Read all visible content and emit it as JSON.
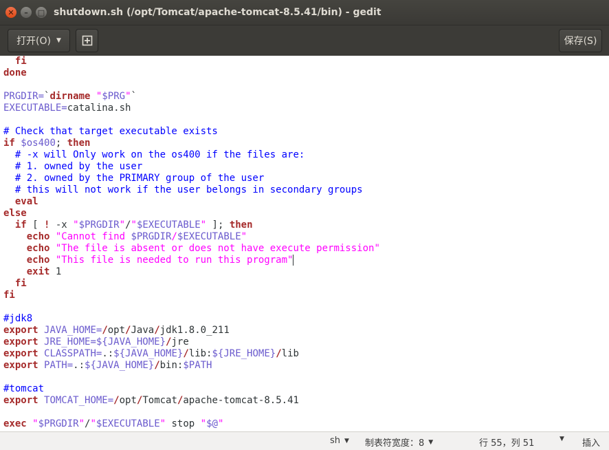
{
  "window": {
    "title": "shutdown.sh (/opt/Tomcat/apache-tomcat-8.5.41/bin) - gedit",
    "close_glyph": "✕",
    "min_glyph": "–",
    "max_glyph": "□"
  },
  "header": {
    "open_label": "打开(O)",
    "open_arrow": "▼",
    "new_tab_glyph": "⊞",
    "save_label": "保存(S)"
  },
  "editor": {
    "lines": [
      [
        {
          "t": "  "
        },
        {
          "t": "fi",
          "c": "kw"
        }
      ],
      [
        {
          "t": "done",
          "c": "kw"
        }
      ],
      [],
      [
        {
          "t": "PRGDIR=",
          "c": "var"
        },
        {
          "t": "`"
        },
        {
          "t": "dirname",
          "c": "kw"
        },
        {
          "t": " "
        },
        {
          "t": "\"",
          "c": "str"
        },
        {
          "t": "$PRG",
          "c": "var"
        },
        {
          "t": "\"",
          "c": "str"
        },
        {
          "t": "`"
        }
      ],
      [
        {
          "t": "EXECUTABLE=",
          "c": "var"
        },
        {
          "t": "catalina.sh"
        }
      ],
      [],
      [
        {
          "t": "# Check that target executable exists",
          "c": "cmt"
        }
      ],
      [
        {
          "t": "if",
          "c": "kw"
        },
        {
          "t": " "
        },
        {
          "t": "$os400",
          "c": "var"
        },
        {
          "t": "; "
        },
        {
          "t": "then",
          "c": "kw"
        }
      ],
      [
        {
          "t": "  "
        },
        {
          "t": "# -x will Only work on the os400 if the files are:",
          "c": "cmt"
        }
      ],
      [
        {
          "t": "  "
        },
        {
          "t": "# 1. owned by the user",
          "c": "cmt"
        }
      ],
      [
        {
          "t": "  "
        },
        {
          "t": "# 2. owned by the PRIMARY group of the user",
          "c": "cmt"
        }
      ],
      [
        {
          "t": "  "
        },
        {
          "t": "# this will not work if the user belongs in secondary groups",
          "c": "cmt"
        }
      ],
      [
        {
          "t": "  "
        },
        {
          "t": "eval",
          "c": "kw"
        }
      ],
      [
        {
          "t": "else",
          "c": "kw"
        }
      ],
      [
        {
          "t": "  "
        },
        {
          "t": "if",
          "c": "kw"
        },
        {
          "t": " [ "
        },
        {
          "t": "!",
          "c": "kw"
        },
        {
          "t": " -x "
        },
        {
          "t": "\"",
          "c": "str"
        },
        {
          "t": "$PRGDIR",
          "c": "var"
        },
        {
          "t": "\"",
          "c": "str"
        },
        {
          "t": "/"
        },
        {
          "t": "\"",
          "c": "str"
        },
        {
          "t": "$EXECUTABLE",
          "c": "var"
        },
        {
          "t": "\"",
          "c": "str"
        },
        {
          "t": " ]; "
        },
        {
          "t": "then",
          "c": "kw"
        }
      ],
      [
        {
          "t": "    "
        },
        {
          "t": "echo",
          "c": "kw"
        },
        {
          "t": " "
        },
        {
          "t": "\"Cannot find ",
          "c": "str"
        },
        {
          "t": "$PRGDIR",
          "c": "var"
        },
        {
          "t": "/",
          "c": "str"
        },
        {
          "t": "$EXECUTABLE",
          "c": "var"
        },
        {
          "t": "\"",
          "c": "str"
        }
      ],
      [
        {
          "t": "    "
        },
        {
          "t": "echo",
          "c": "kw"
        },
        {
          "t": " "
        },
        {
          "t": "\"The file is absent or does not have execute permission\"",
          "c": "str"
        }
      ],
      [
        {
          "t": "    "
        },
        {
          "t": "echo",
          "c": "kw"
        },
        {
          "t": " "
        },
        {
          "t": "\"This file is needed to run this program\"",
          "c": "str"
        },
        {
          "cursor": true
        }
      ],
      [
        {
          "t": "    "
        },
        {
          "t": "exit",
          "c": "kw"
        },
        {
          "t": " 1"
        }
      ],
      [
        {
          "t": "  "
        },
        {
          "t": "fi",
          "c": "kw"
        }
      ],
      [
        {
          "t": "fi",
          "c": "kw"
        }
      ],
      [],
      [
        {
          "t": "#jdk8",
          "c": "cmt"
        }
      ],
      [
        {
          "t": "export",
          "c": "kw"
        },
        {
          "t": " "
        },
        {
          "t": "JAVA_HOME=",
          "c": "var"
        },
        {
          "t": "/",
          "c": "kw"
        },
        {
          "t": "opt"
        },
        {
          "t": "/",
          "c": "kw"
        },
        {
          "t": "Java"
        },
        {
          "t": "/",
          "c": "kw"
        },
        {
          "t": "jdk1.8.0_211"
        }
      ],
      [
        {
          "t": "export",
          "c": "kw"
        },
        {
          "t": " "
        },
        {
          "t": "JRE_HOME=",
          "c": "var"
        },
        {
          "t": "${JAVA_HOME}",
          "c": "var"
        },
        {
          "t": "/",
          "c": "kw"
        },
        {
          "t": "jre"
        }
      ],
      [
        {
          "t": "export",
          "c": "kw"
        },
        {
          "t": " "
        },
        {
          "t": "CLASSPATH=",
          "c": "var"
        },
        {
          "t": ".:"
        },
        {
          "t": "${JAVA_HOME}",
          "c": "var"
        },
        {
          "t": "/",
          "c": "kw"
        },
        {
          "t": "lib:"
        },
        {
          "t": "${JRE_HOME}",
          "c": "var"
        },
        {
          "t": "/",
          "c": "kw"
        },
        {
          "t": "lib"
        }
      ],
      [
        {
          "t": "export",
          "c": "kw"
        },
        {
          "t": " "
        },
        {
          "t": "PATH=",
          "c": "var"
        },
        {
          "t": ".:"
        },
        {
          "t": "${JAVA_HOME}",
          "c": "var"
        },
        {
          "t": "/",
          "c": "kw"
        },
        {
          "t": "bin:"
        },
        {
          "t": "$PATH",
          "c": "var"
        }
      ],
      [],
      [
        {
          "t": "#tomcat",
          "c": "cmt"
        }
      ],
      [
        {
          "t": "export",
          "c": "kw"
        },
        {
          "t": " "
        },
        {
          "t": "TOMCAT_HOME=",
          "c": "var"
        },
        {
          "t": "/",
          "c": "kw"
        },
        {
          "t": "opt"
        },
        {
          "t": "/",
          "c": "kw"
        },
        {
          "t": "Tomcat"
        },
        {
          "t": "/",
          "c": "kw"
        },
        {
          "t": "apache-tomcat-8.5.41"
        }
      ],
      [],
      [
        {
          "t": "exec",
          "c": "kw"
        },
        {
          "t": " "
        },
        {
          "t": "\"",
          "c": "str"
        },
        {
          "t": "$PRGDIR",
          "c": "var"
        },
        {
          "t": "\"",
          "c": "str"
        },
        {
          "t": "/"
        },
        {
          "t": "\"",
          "c": "str"
        },
        {
          "t": "$EXECUTABLE",
          "c": "var"
        },
        {
          "t": "\"",
          "c": "str"
        },
        {
          "t": " stop "
        },
        {
          "t": "\"",
          "c": "str"
        },
        {
          "t": "$@",
          "c": "var"
        },
        {
          "t": "\"",
          "c": "str"
        }
      ]
    ]
  },
  "statusbar": {
    "language": "sh",
    "tab_width": "制表符宽度：8",
    "position": "行 55，列 51",
    "mode": "插入",
    "arrow": "▼"
  }
}
